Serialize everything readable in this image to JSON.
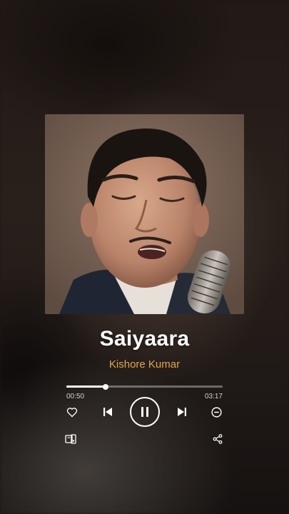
{
  "track": {
    "title": "Saiyaara",
    "artist": "Kishore Kumar"
  },
  "playback": {
    "elapsed": "00:50",
    "duration": "03:17",
    "progress_fraction": 0.25,
    "state": "playing"
  },
  "colors": {
    "artist_accent": "#e0a64f",
    "title": "#ffffff"
  },
  "icons": {
    "like": "heart-icon",
    "previous": "skip-previous-icon",
    "pause": "pause-icon",
    "next": "skip-next-icon",
    "remove": "minus-circle-icon",
    "device": "device-connect-icon",
    "share": "share-icon"
  }
}
